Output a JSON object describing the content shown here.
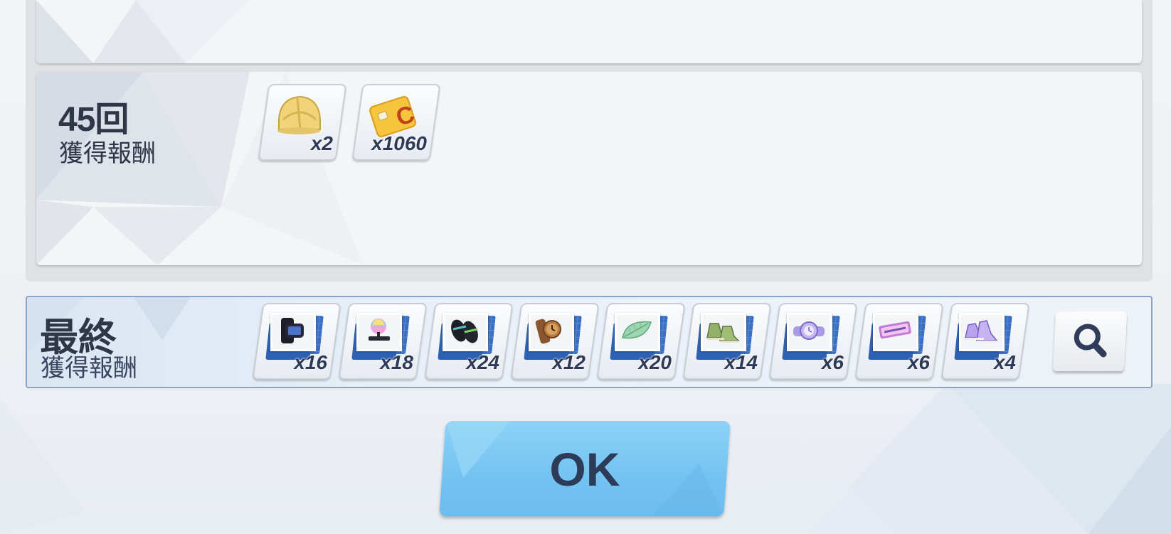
{
  "round_row": {
    "round_label": "45回",
    "reward_label": "獲得報酬",
    "items": [
      {
        "icon": "gold-headgear-icon",
        "qty": "x2"
      },
      {
        "icon": "gold-coin-card-icon",
        "qty": "x1060"
      }
    ]
  },
  "final_row": {
    "title": "最終",
    "reward_label": "獲得報酬",
    "items": [
      {
        "icon": "black-smartwatch-icon",
        "qty": "x16"
      },
      {
        "icon": "rainbow-brooch-icon",
        "qty": "x18"
      },
      {
        "icon": "black-sandals-icon",
        "qty": "x24"
      },
      {
        "icon": "brown-wristwatch-icon",
        "qty": "x12"
      },
      {
        "icon": "green-leaf-icon",
        "qty": "x20"
      },
      {
        "icon": "green-sneakers-icon",
        "qty": "x14"
      },
      {
        "icon": "purple-watch-icon",
        "qty": "x6"
      },
      {
        "icon": "jump-badge-icon",
        "qty": "x6"
      },
      {
        "icon": "purple-sneakers-icon",
        "qty": "x4"
      }
    ],
    "search_icon": "magnifier-icon"
  },
  "ok_button": {
    "label": "OK"
  },
  "colors": {
    "ok_button": "#7cc8f3",
    "final_border": "#8aa2c6",
    "text": "#2e3648"
  }
}
